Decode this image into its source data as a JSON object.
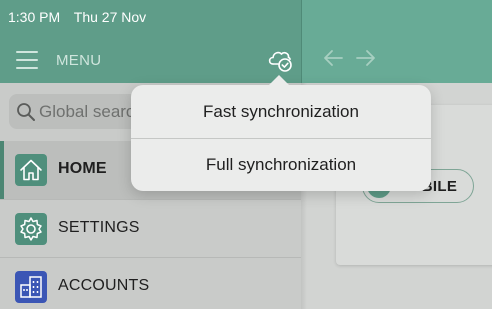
{
  "status_bar": {
    "time": "1:30 PM",
    "date": "Thu 27 Nov"
  },
  "header": {
    "menu_label": "MENU",
    "sync_icon": "cloud-check-icon",
    "back_icon": "arrow-left-icon",
    "forward_icon": "arrow-right-icon"
  },
  "search": {
    "placeholder": "Global search",
    "value": ""
  },
  "nav": {
    "items": [
      {
        "label": "HOME",
        "icon": "home-icon",
        "active": true
      },
      {
        "label": "SETTINGS",
        "icon": "gear-icon",
        "active": false
      },
      {
        "label": "ACCOUNTS",
        "icon": "buildings-icon",
        "active": false
      }
    ]
  },
  "sync_menu": {
    "items": [
      {
        "label": "Fast synchronization"
      },
      {
        "label": "Full synchronization"
      }
    ]
  },
  "content": {
    "mobile_label": "MOBILE"
  },
  "colors": {
    "header_green": "#5f9d89",
    "home_icon_bg": "#4f8f7c",
    "settings_icon_bg": "#4f8f7c",
    "accounts_icon_bg": "#3b56b5"
  }
}
